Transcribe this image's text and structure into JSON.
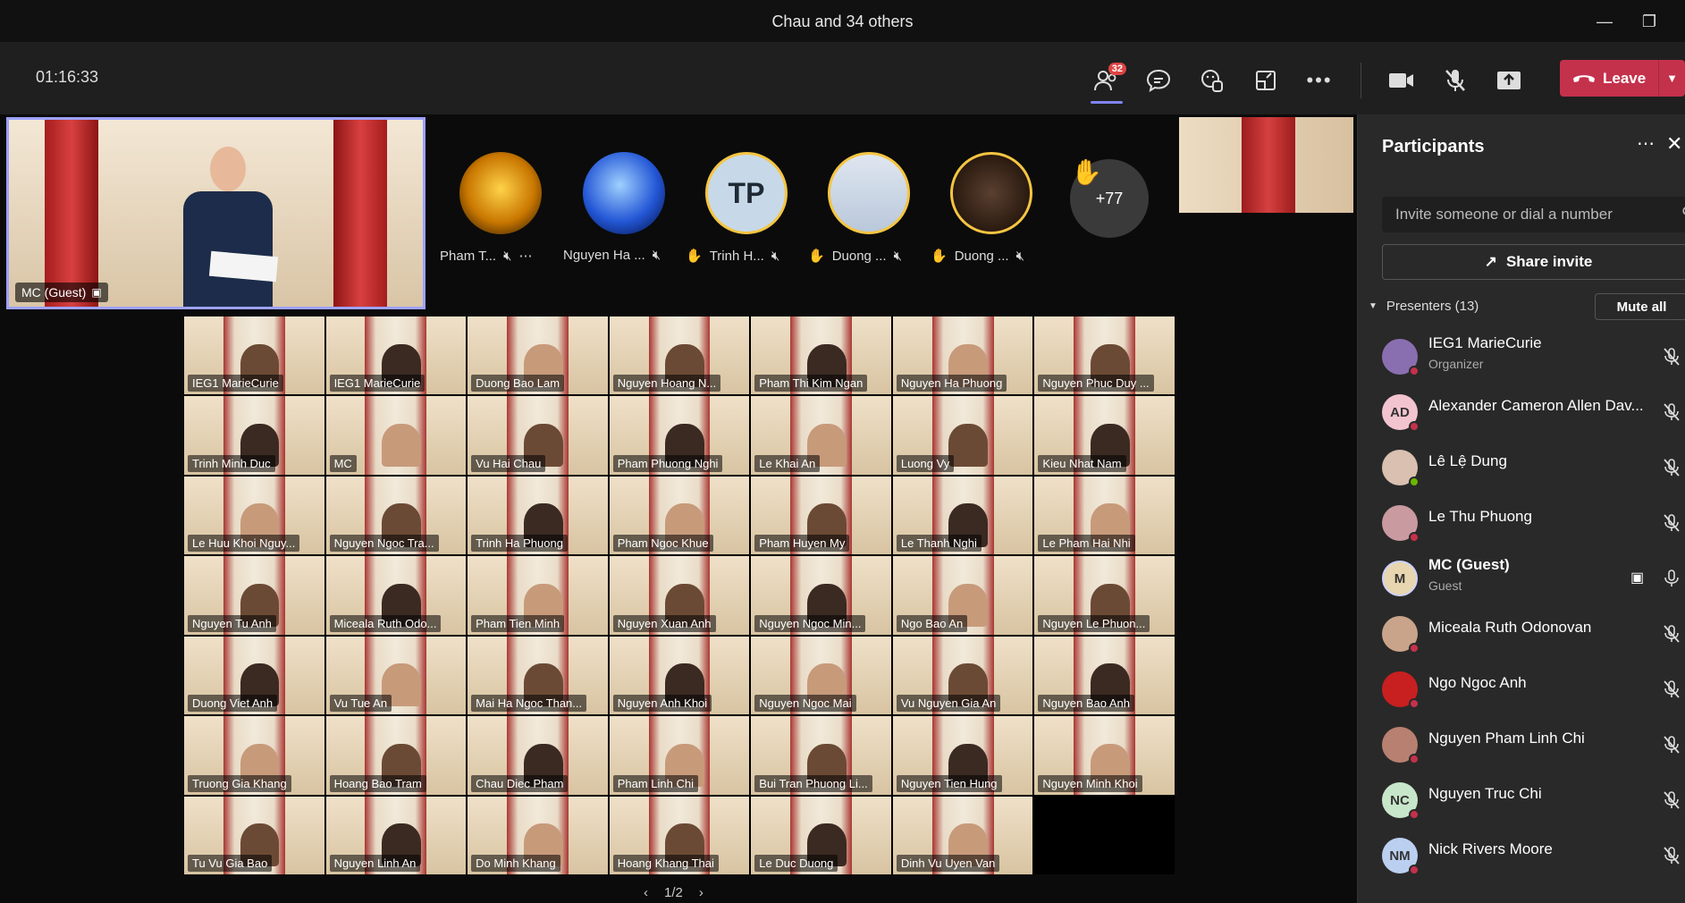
{
  "window": {
    "title": "Chau and 34 others"
  },
  "toolbar": {
    "timer": "01:16:33",
    "participants_badge": "32",
    "leave_label": "Leave"
  },
  "spotlight": {
    "name": "MC (Guest)"
  },
  "avatars": [
    {
      "name": "Pham T...",
      "hand": false,
      "initials": ""
    },
    {
      "name": "Nguyen Ha ...",
      "hand": false,
      "initials": ""
    },
    {
      "name": "Trinh H...",
      "hand": true,
      "initials": "TP"
    },
    {
      "name": "Duong ...",
      "hand": true,
      "initials": ""
    },
    {
      "name": "Duong ...",
      "hand": true,
      "initials": ""
    }
  ],
  "more_count": "+77",
  "grid_tiles": [
    "IEG1 MarieCurie",
    "IEG1 MarieCurie",
    "Duong Bao Lam",
    "Nguyen Hoang N...",
    "Pham Thi Kim Ngan",
    "Nguyen Ha Phuong",
    "Nguyen Phuc Duy ...",
    "Trinh Minh Duc",
    "MC",
    "Vu Hai Chau",
    "Pham Phuong Nghi",
    "Le Khai An",
    "Luong Vy",
    "Kieu Nhat Nam",
    "Le Huu Khoi Nguy...",
    "Nguyen Ngoc Tra...",
    "Trinh Ha Phuong",
    "Pham Ngoc Khue",
    "Pham Huyen My",
    "Le Thanh Nghi",
    "Le Pham Hai Nhi",
    "Nguyen Tu Anh",
    "Miceala Ruth Odo...",
    "Pham Tien Minh",
    "Nguyen Xuan Anh",
    "Nguyen Ngoc Min...",
    "Ngo Bao An",
    "Nguyen Le Phuon...",
    "Duong Viet Anh",
    "Vu Tue An",
    "Mai Ha Ngoc Than...",
    "Nguyen Anh Khoi",
    "Nguyen Ngoc Mai",
    "Vu Nguyen Gia An",
    "Nguyen Bao Anh",
    "Truong Gia Khang",
    "Hoang Bao Tram",
    "Chau Diec Pham",
    "Pham Linh Chi",
    "Bui Tran Phuong Li...",
    "Nguyen Tien Hung",
    "Nguyen Minh Khoi",
    "Tu Vu Gia Bao",
    "Nguyen Linh An",
    "Do Minh Khang",
    "Hoang Khang Thai",
    "Le Duc Duong",
    "Dinh Vu Uyen Van",
    ""
  ],
  "pager": "1/2",
  "participants_panel": {
    "title": "Participants",
    "invite_placeholder": "Invite someone or dial a number",
    "share_invite": "Share invite",
    "presenters_label": "Presenters (13)",
    "mute_all": "Mute all",
    "people": [
      {
        "name": "IEG1 MarieCurie",
        "sub": "Organizer",
        "initials": "",
        "color": "#8a6fb0",
        "dot": "red"
      },
      {
        "name": "Alexander Cameron Allen Dav...",
        "sub": "",
        "initials": "AD",
        "color": "#f2c4cf",
        "dot": "red"
      },
      {
        "name": "Lê Lệ Dung",
        "sub": "",
        "initials": "",
        "color": "#d9c0b0",
        "dot": "green"
      },
      {
        "name": "Le Thu Phuong",
        "sub": "",
        "initials": "",
        "color": "#c99aa0",
        "dot": "red"
      },
      {
        "name": "MC (Guest)",
        "sub": "Guest",
        "initials": "M",
        "color": "#e8d6b0",
        "dot": ""
      },
      {
        "name": "Miceala Ruth Odonovan",
        "sub": "",
        "initials": "",
        "color": "#c9a48a",
        "dot": "red"
      },
      {
        "name": "Ngo Ngoc Anh",
        "sub": "",
        "initials": "",
        "color": "#c82020",
        "dot": "red"
      },
      {
        "name": "Nguyen Pham Linh Chi",
        "sub": "",
        "initials": "",
        "color": "#b88070",
        "dot": "red"
      },
      {
        "name": "Nguyen Truc Chi",
        "sub": "",
        "initials": "NC",
        "color": "#c8e6c9",
        "dot": "red"
      },
      {
        "name": "Nick Rivers Moore",
        "sub": "",
        "initials": "NM",
        "color": "#bbd0f0",
        "dot": "red"
      }
    ]
  }
}
